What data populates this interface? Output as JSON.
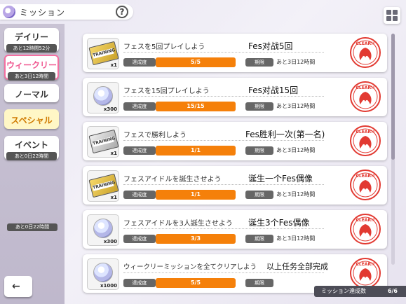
{
  "header": {
    "title": "ミッション",
    "help_label": "?"
  },
  "sidebar": {
    "tabs": [
      {
        "label": "デイリー",
        "sub": "あと12時間52分"
      },
      {
        "label": "ウィークリー",
        "sub": "あと3日12時間"
      },
      {
        "label": "ノーマル",
        "sub": ""
      },
      {
        "label": "スペシャル",
        "sub": ""
      },
      {
        "label": "イベント",
        "sub": "あと0日22時間"
      }
    ],
    "extra_time": "あと0日22時間",
    "back_label": "←"
  },
  "missions": [
    {
      "title": "フェスを5回プレイしよう",
      "note": "Fes对战5回",
      "reward_type": "training-ticket-gold",
      "reward_label": "TRAINING",
      "reward_qty": "x1",
      "achievement_label": "達成度",
      "progress_text": "5/5",
      "progress": 1.0,
      "term_label": "期限",
      "term_value": "あと3日12時間",
      "status": "CLEAR!!"
    },
    {
      "title": "フェスを15回プレイしよう",
      "note": "Fes对战15回",
      "reward_type": "jewel",
      "reward_label": "",
      "reward_qty": "x300",
      "achievement_label": "達成度",
      "progress_text": "15/15",
      "progress": 1.0,
      "term_label": "期限",
      "term_value": "あと3日12時間",
      "status": "CLEAR!!"
    },
    {
      "title": "フェスで勝利しよう",
      "note": "Fes胜利一次(第一名)",
      "reward_type": "training-ticket-silver",
      "reward_label": "TRAINING",
      "reward_qty": "x1",
      "achievement_label": "達成度",
      "progress_text": "1/1",
      "progress": 1.0,
      "term_label": "期限",
      "term_value": "あと3日12時間",
      "status": "CLEAR!!"
    },
    {
      "title": "フェスアイドルを誕生させよう",
      "note": "诞生一个Fes偶像",
      "reward_type": "training-ticket-gold",
      "reward_label": "TRAINING",
      "reward_qty": "x1",
      "achievement_label": "達成度",
      "progress_text": "1/1",
      "progress": 1.0,
      "term_label": "期限",
      "term_value": "あと3日12時間",
      "status": "CLEAR!!"
    },
    {
      "title": "フェスアイドルを3人誕生させよう",
      "note": "诞生3个Fes偶像",
      "reward_type": "jewel",
      "reward_label": "",
      "reward_qty": "x300",
      "achievement_label": "達成度",
      "progress_text": "3/3",
      "progress": 1.0,
      "term_label": "期限",
      "term_value": "あと3日12時間",
      "status": "CLEAR!!"
    },
    {
      "title": "ウィークリーミッションを全てクリアしよう",
      "note": "以上任务全部完成",
      "reward_type": "jewel",
      "reward_label": "",
      "reward_qty": "x1000",
      "achievement_label": "達成度",
      "progress_text": "5/5",
      "progress": 1.0,
      "term_label": "期限",
      "term_value": "",
      "status": "CLEAR!!"
    }
  ],
  "footer": {
    "label": "ミッション達成数",
    "value": "6/6"
  },
  "colors": {
    "accent_pink": "#f05a92",
    "progress_orange": "#f5800a",
    "stamp_red": "#e23a32"
  }
}
